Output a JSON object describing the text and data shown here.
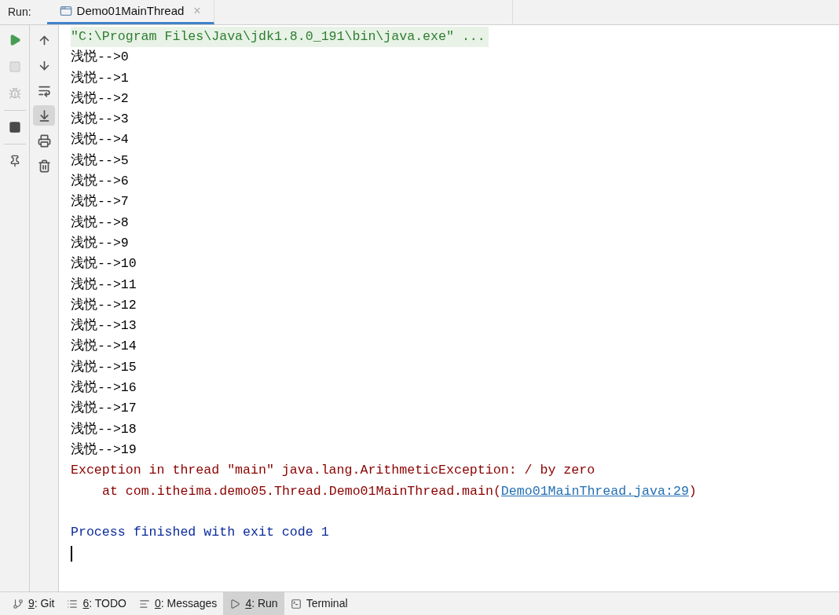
{
  "run_header": {
    "label": "Run:",
    "tabs": [
      {
        "title": "Demo01MainThread",
        "close": "×",
        "selected": true
      }
    ]
  },
  "left_toolbar": [
    {
      "disabled": false
    },
    {
      "disabled": true
    },
    {
      "disabled": true
    },
    {
      "disabled": false
    },
    {
      "disabled": false
    }
  ],
  "console_toolbar": [
    {
      "selected": false
    },
    {
      "selected": false
    },
    {
      "selected": false
    },
    {
      "selected": true
    },
    {
      "selected": false
    },
    {
      "selected": false
    }
  ],
  "console": [
    {
      "kind": "command",
      "text": "\"C:\\Program Files\\Java\\jdk1.8.0_191\\bin\\java.exe\" ..."
    },
    {
      "kind": "stdout",
      "text": "浅悦-->0"
    },
    {
      "kind": "stdout",
      "text": "浅悦-->1"
    },
    {
      "kind": "stdout",
      "text": "浅悦-->2"
    },
    {
      "kind": "stdout",
      "text": "浅悦-->3"
    },
    {
      "kind": "stdout",
      "text": "浅悦-->4"
    },
    {
      "kind": "stdout",
      "text": "浅悦-->5"
    },
    {
      "kind": "stdout",
      "text": "浅悦-->6"
    },
    {
      "kind": "stdout",
      "text": "浅悦-->7"
    },
    {
      "kind": "stdout",
      "text": "浅悦-->8"
    },
    {
      "kind": "stdout",
      "text": "浅悦-->9"
    },
    {
      "kind": "stdout",
      "text": "浅悦-->10"
    },
    {
      "kind": "stdout",
      "text": "浅悦-->11"
    },
    {
      "kind": "stdout",
      "text": "浅悦-->12"
    },
    {
      "kind": "stdout",
      "text": "浅悦-->13"
    },
    {
      "kind": "stdout",
      "text": "浅悦-->14"
    },
    {
      "kind": "stdout",
      "text": "浅悦-->15"
    },
    {
      "kind": "stdout",
      "text": "浅悦-->16"
    },
    {
      "kind": "stdout",
      "text": "浅悦-->17"
    },
    {
      "kind": "stdout",
      "text": "浅悦-->18"
    },
    {
      "kind": "stdout",
      "text": "浅悦-->19"
    },
    {
      "kind": "error",
      "text": "Exception in thread \"main\" java.lang.ArithmeticException: / by zero"
    },
    {
      "kind": "trace",
      "text": "at com.itheima.demo05.Thread.Demo01MainThread.main(",
      "link": "Demo01MainThread.java:29",
      "after": ")"
    },
    {
      "kind": "blank"
    },
    {
      "kind": "exit",
      "text": "Process finished with exit code 1"
    },
    {
      "kind": "cursor"
    }
  ],
  "bottom_bar": [
    {
      "mnemonic": "9",
      "label": ": Git",
      "selected": false
    },
    {
      "mnemonic": "6",
      "label": ": TODO",
      "selected": false
    },
    {
      "mnemonic": "0",
      "label": ": Messages",
      "selected": false
    },
    {
      "mnemonic": "4",
      "label": ": Run",
      "selected": true
    },
    {
      "label": "Terminal",
      "selected": false
    }
  ]
}
